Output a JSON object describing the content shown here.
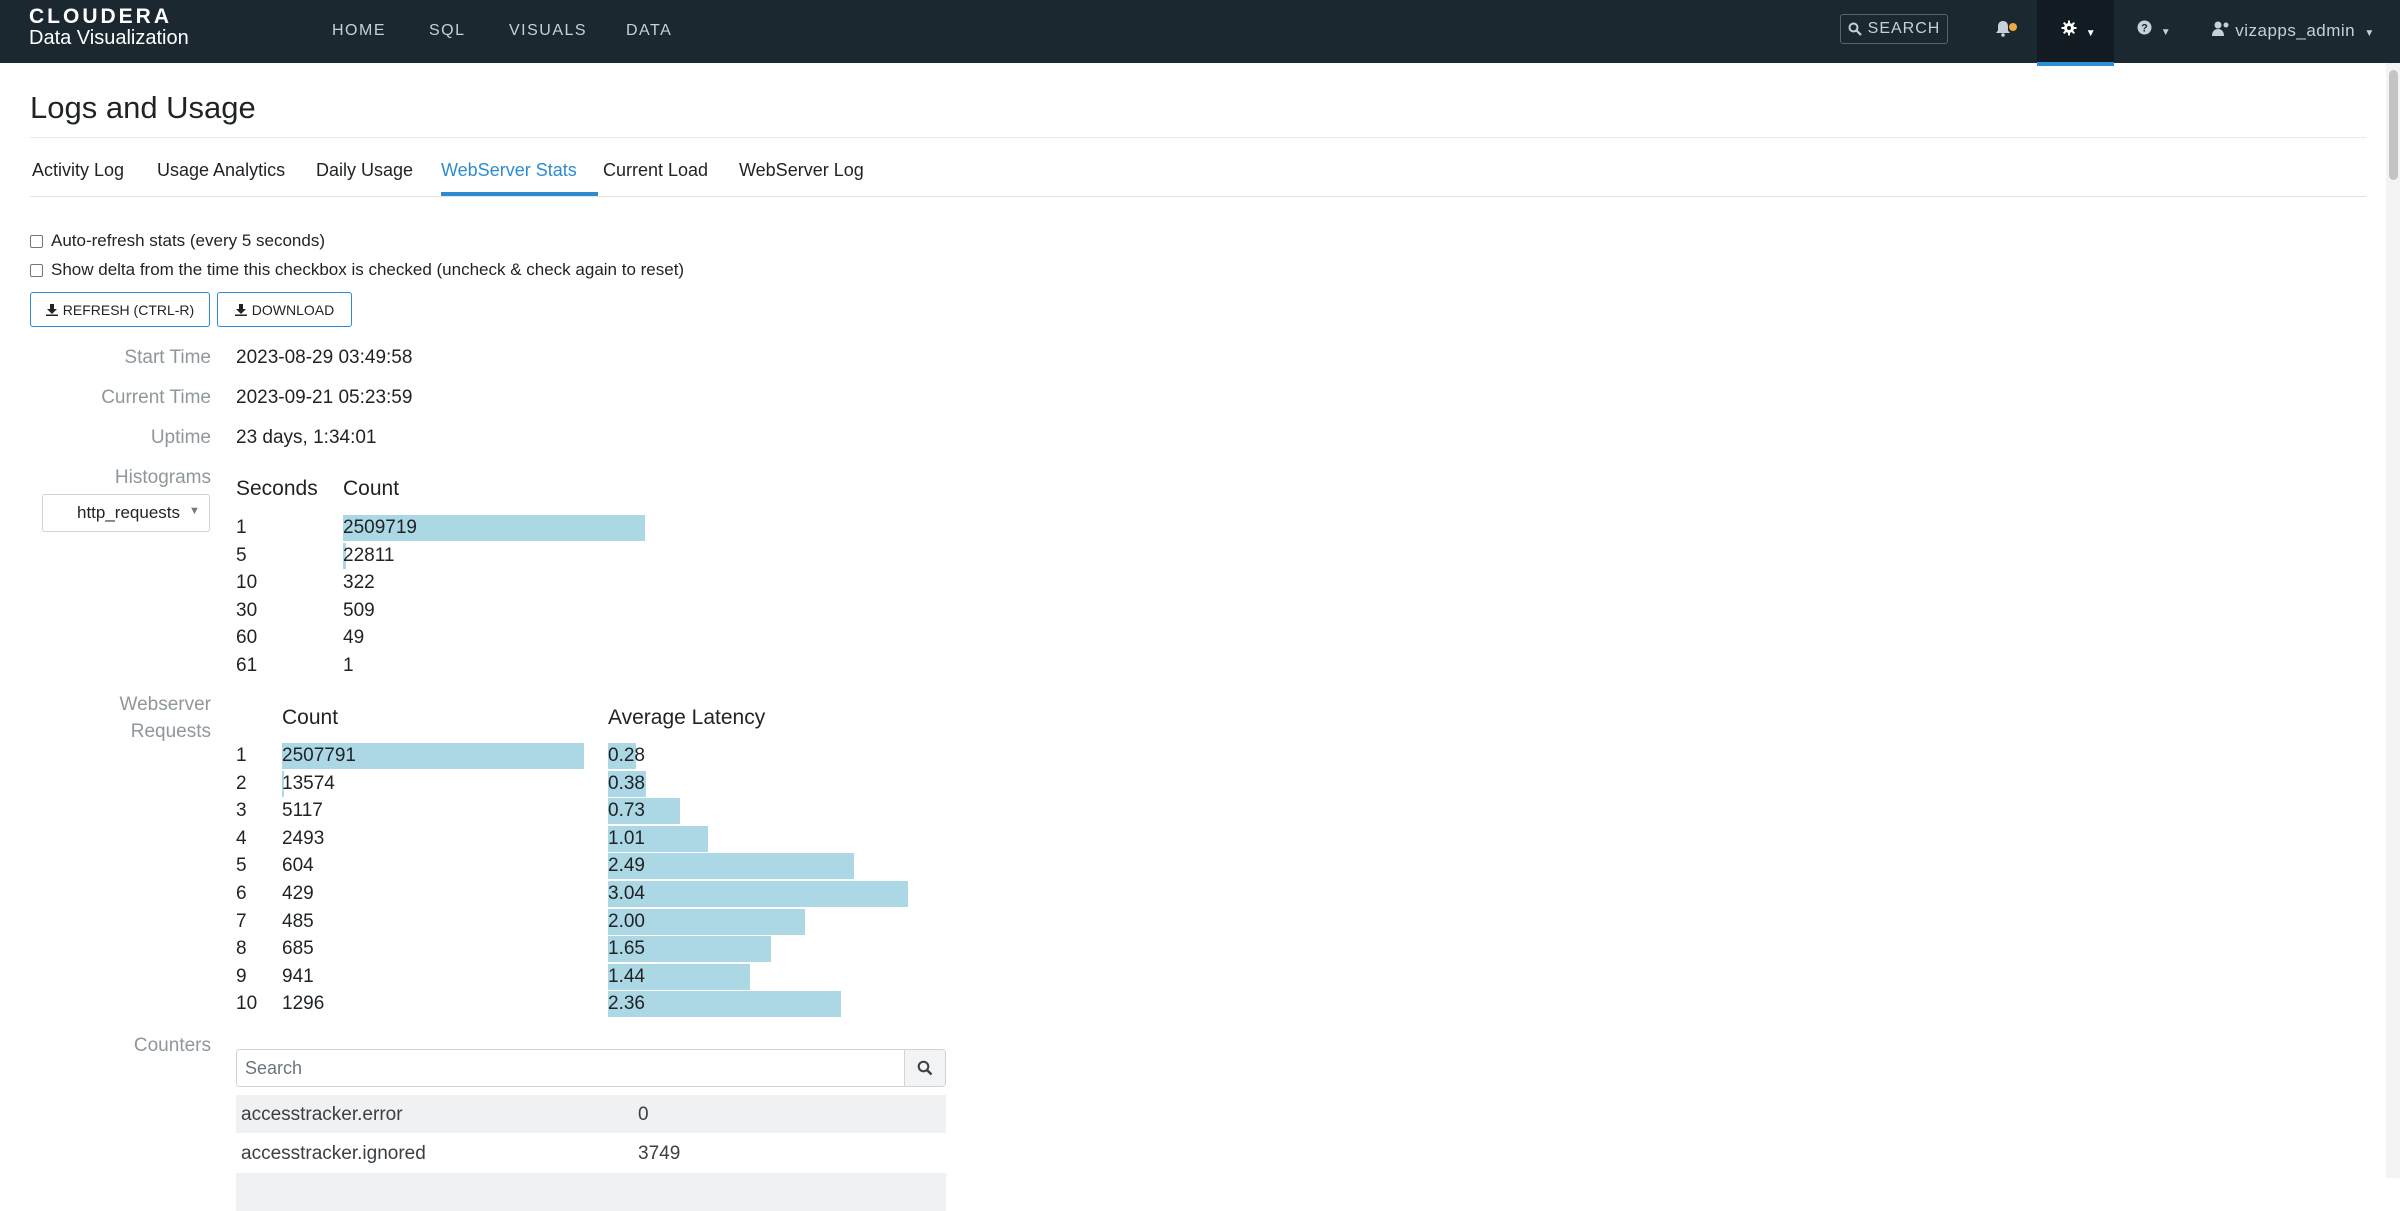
{
  "app": {
    "logo_top": "CLOUDERA",
    "logo_bottom": "Data Visualization"
  },
  "nav": {
    "items": [
      "HOME",
      "SQL",
      "VISUALS",
      "DATA"
    ],
    "search_label": "SEARCH",
    "user": "vizapps_admin"
  },
  "page": {
    "title": "Logs and Usage"
  },
  "tabs": [
    {
      "label": "Activity Log",
      "active": false
    },
    {
      "label": "Usage Analytics",
      "active": false
    },
    {
      "label": "Daily Usage",
      "active": false
    },
    {
      "label": "WebServer Stats",
      "active": true
    },
    {
      "label": "Current Load",
      "active": false
    },
    {
      "label": "WebServer Log",
      "active": false
    }
  ],
  "options": {
    "auto_refresh": "Auto-refresh stats (every 5 seconds)",
    "show_delta": "Show delta from the time this checkbox is checked (uncheck & check again to reset)"
  },
  "buttons": {
    "refresh": "REFRESH (CTRL-R)",
    "download": "DOWNLOAD"
  },
  "stats": {
    "start_time_label": "Start Time",
    "start_time": "2023-08-29 03:49:58",
    "current_time_label": "Current Time",
    "current_time": "2023-09-21 05:23:59",
    "uptime_label": "Uptime",
    "uptime": "23 days, 1:34:01"
  },
  "histograms": {
    "label": "Histograms",
    "selected": "http_requests",
    "col_seconds": "Seconds",
    "col_count": "Count",
    "rows": [
      {
        "seconds": "1",
        "count": "2509719",
        "fraction": 1.0
      },
      {
        "seconds": "5",
        "count": "22811",
        "fraction": 0.009
      },
      {
        "seconds": "10",
        "count": "322",
        "fraction": 0.0
      },
      {
        "seconds": "30",
        "count": "509",
        "fraction": 0.0
      },
      {
        "seconds": "60",
        "count": "49",
        "fraction": 0.0
      },
      {
        "seconds": "61",
        "count": "1",
        "fraction": 0.0
      }
    ]
  },
  "webserver_requests": {
    "label_line1": "Webserver",
    "label_line2": "Requests",
    "col_count": "Count",
    "col_latency": "Average Latency",
    "rows": [
      {
        "idx": "1",
        "count": "2507791",
        "count_fraction": 1.0,
        "latency": "0.28"
      },
      {
        "idx": "2",
        "count": "13574",
        "count_fraction": 0.005,
        "latency": "0.38"
      },
      {
        "idx": "3",
        "count": "5117",
        "count_fraction": 0.002,
        "latency": "0.73"
      },
      {
        "idx": "4",
        "count": "2493",
        "count_fraction": 0.001,
        "latency": "1.01"
      },
      {
        "idx": "5",
        "count": "604",
        "count_fraction": 0.0,
        "latency": "2.49"
      },
      {
        "idx": "6",
        "count": "429",
        "count_fraction": 0.0,
        "latency": "3.04"
      },
      {
        "idx": "7",
        "count": "485",
        "count_fraction": 0.0,
        "latency": "2.00"
      },
      {
        "idx": "8",
        "count": "685",
        "count_fraction": 0.0,
        "latency": "1.65"
      },
      {
        "idx": "9",
        "count": "941",
        "count_fraction": 0.0,
        "latency": "1.44"
      },
      {
        "idx": "10",
        "count": "1296",
        "count_fraction": 0.001,
        "latency": "2.36"
      }
    ]
  },
  "counters": {
    "label": "Counters",
    "search_placeholder": "Search",
    "rows": [
      {
        "name": "accesstracker.error",
        "value": "0"
      },
      {
        "name": "accesstracker.ignored",
        "value": "3749"
      },
      {
        "name": "",
        "value": ""
      }
    ]
  },
  "colors": {
    "navbar": "#1b2830",
    "accent": "#2e8bd0",
    "bar": "#acd7e4",
    "notification_dot": "#f0a93b"
  }
}
